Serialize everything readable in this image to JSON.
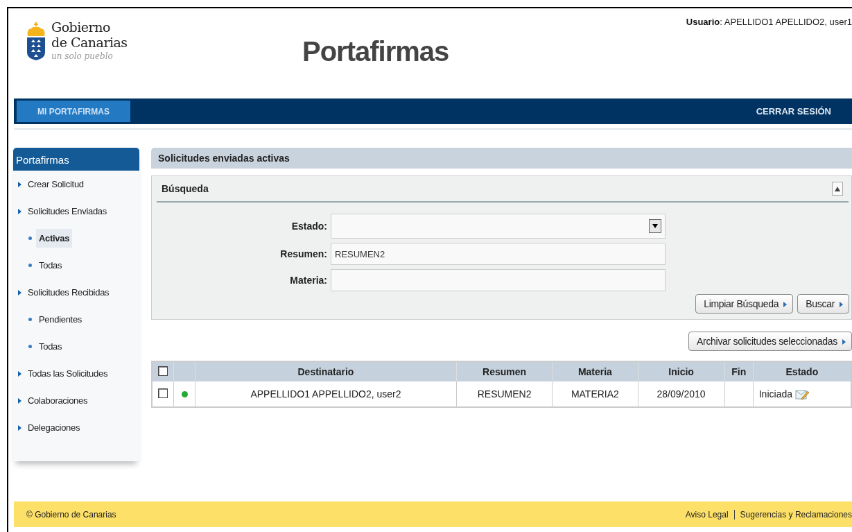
{
  "header": {
    "logo": {
      "line1": "Gobierno",
      "line2": "de Canarias",
      "tagline": "un solo pueblo"
    },
    "title": "Portafirmas",
    "user": {
      "label": "Usuario",
      "value": ": APELLIDO1 APELLIDO2, user1"
    }
  },
  "nav": {
    "tabs": [
      {
        "label": "MI PORTAFIRMAS",
        "selected": true
      }
    ],
    "logout": "CERRAR SESIÓN"
  },
  "sidebar": {
    "title": "Portafirmas",
    "items": [
      {
        "label": "Crear Solicitud",
        "selected": false
      },
      {
        "label": "Solicitudes Enviadas",
        "selected": false,
        "children": [
          {
            "label": "Activas",
            "selected": true
          },
          {
            "label": "Todas",
            "selected": false
          }
        ]
      },
      {
        "label": "Solicitudes Recibidas",
        "selected": false,
        "children": [
          {
            "label": "Pendientes",
            "selected": false
          },
          {
            "label": "Todas",
            "selected": false
          }
        ]
      },
      {
        "label": "Todas las Solicitudes",
        "selected": false
      },
      {
        "label": "Colaboraciones",
        "selected": false
      },
      {
        "label": "Delegaciones",
        "selected": false
      }
    ]
  },
  "main": {
    "heading": "Solicitudes enviadas activas",
    "search": {
      "title": "Búsqueda",
      "expanded": true,
      "fields": [
        {
          "label": "Estado:",
          "kind": "select"
        },
        {
          "label": "Resumen:",
          "kind": "text",
          "value": "RESUMEN2"
        },
        {
          "label": "Materia:",
          "kind": "text"
        }
      ],
      "buttons": [
        "Limpiar Búsqueda",
        "Buscar"
      ]
    },
    "archive_button": "Archivar solicitudes seleccionadas",
    "table": {
      "select_all": false,
      "columns": [
        "Destinatario",
        "Resumen",
        "Materia",
        "Inicio",
        "Fin",
        "Estado"
      ],
      "rows": [
        {
          "checked": false,
          "color": "#22aa33",
          "cells": [
            "APPELLIDO1 APPELLIDO2, user2",
            "RESUMEN2",
            "MATERIA2",
            "28/09/2010",
            "",
            "Iniciada"
          ]
        }
      ]
    }
  },
  "footer": {
    "copyright": "© Gobierno de Canarias",
    "links": [
      "Aviso Legal",
      "Sugerencias y Reclamaciones"
    ]
  }
}
